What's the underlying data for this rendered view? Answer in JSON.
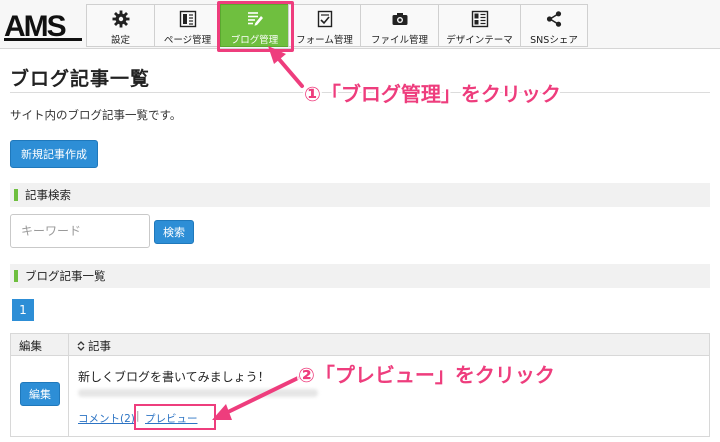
{
  "app": {
    "logo": "AMS"
  },
  "nav": {
    "items": [
      {
        "label": "設定",
        "icon": "gear-icon",
        "active": false
      },
      {
        "label": "ページ管理",
        "icon": "page-icon",
        "active": false
      },
      {
        "label": "ブログ管理",
        "icon": "blog-edit-icon",
        "active": true
      },
      {
        "label": "フォーム管理",
        "icon": "form-icon",
        "active": false
      },
      {
        "label": "ファイル管理",
        "icon": "camera-icon",
        "active": false
      },
      {
        "label": "デザインテーマ",
        "icon": "layout-icon",
        "active": false
      },
      {
        "label": "SNSシェア",
        "icon": "share-icon",
        "active": false
      }
    ]
  },
  "page": {
    "title": "ブログ記事一覧",
    "description": "サイト内のブログ記事一覧です。",
    "new_button": "新規記事作成"
  },
  "search": {
    "section_title": "記事検索",
    "placeholder": "キーワード",
    "button": "検索"
  },
  "list": {
    "section_title": "ブログ記事一覧",
    "page": "1",
    "columns": [
      "編集",
      "記事"
    ],
    "sort_icon": "sort-icon",
    "rows": [
      {
        "edit_label": "編集",
        "title": "新しくブログを書いてみましょう！",
        "comment_link": "コメント(2)",
        "separator": "|",
        "preview_link": "プレビュー"
      }
    ]
  },
  "annotations": {
    "step1": "①「ブログ管理」をクリック",
    "step2": "②「プレビュー」をクリック",
    "color": "#ee3d7d"
  },
  "colors": {
    "accent_blue": "#2d8ed6",
    "active_green": "#6fbf3f"
  }
}
